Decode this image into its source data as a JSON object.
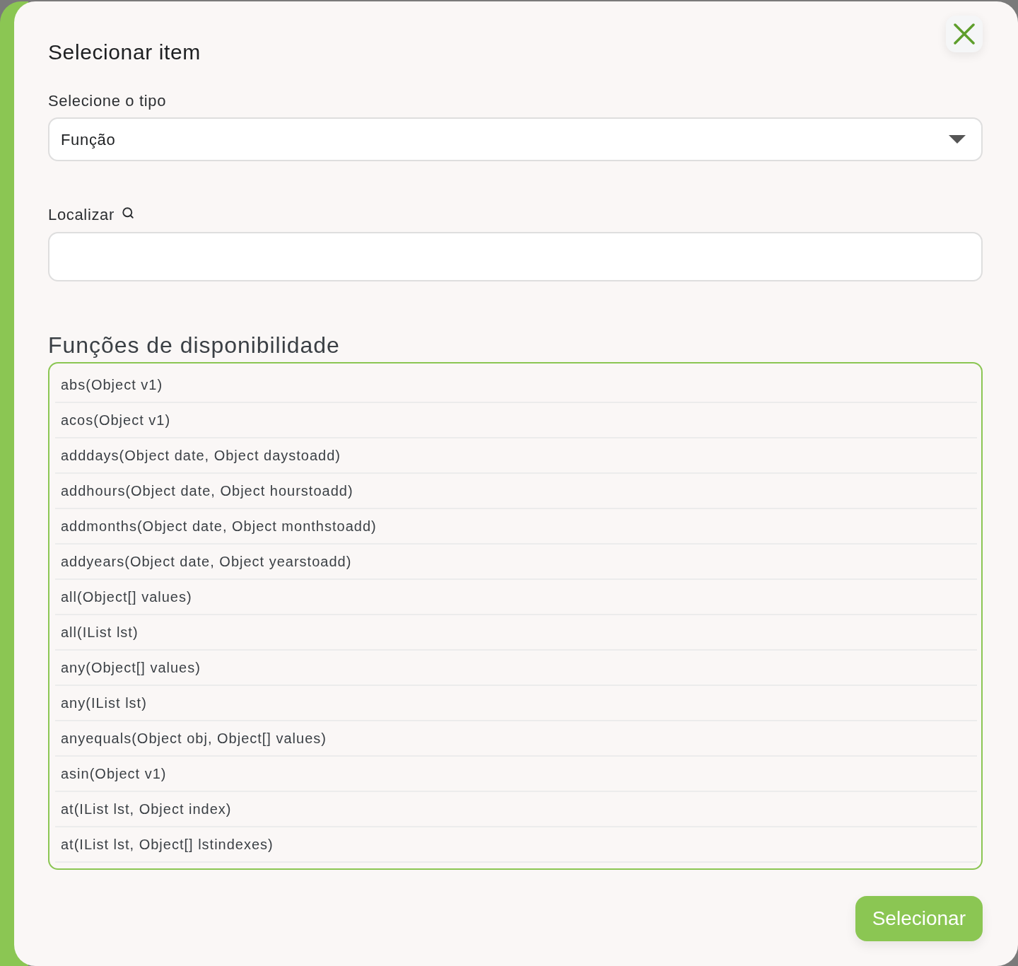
{
  "dialog": {
    "title": "Selecionar item"
  },
  "type_select": {
    "label": "Selecione o tipo",
    "value": "Função"
  },
  "search": {
    "label": "Localizar"
  },
  "functions": {
    "heading": "Funções de disponibilidade",
    "items": [
      {
        "label": "abs(Object v1)",
        "selected": false
      },
      {
        "label": "acos(Object v1)",
        "selected": false
      },
      {
        "label": "adddays(Object date, Object daystoadd)",
        "selected": false
      },
      {
        "label": "addhours(Object date, Object hourstoadd)",
        "selected": false
      },
      {
        "label": "addmonths(Object date, Object monthstoadd)",
        "selected": false
      },
      {
        "label": "addyears(Object date, Object yearstoadd)",
        "selected": false
      },
      {
        "label": "all(Object[] values)",
        "selected": false
      },
      {
        "label": "all(IList lst)",
        "selected": false
      },
      {
        "label": "any(Object[] values)",
        "selected": false
      },
      {
        "label": "any(IList lst)",
        "selected": false
      },
      {
        "label": "anyequals(Object obj, Object[] values)",
        "selected": false
      },
      {
        "label": "asin(Object v1)",
        "selected": false
      },
      {
        "label": "at(IList lst, Object index)",
        "selected": false
      },
      {
        "label": "at(IList lst, Object[] lstindexes)",
        "selected": false
      }
    ]
  },
  "primary_button": {
    "label": "Selecionar"
  }
}
